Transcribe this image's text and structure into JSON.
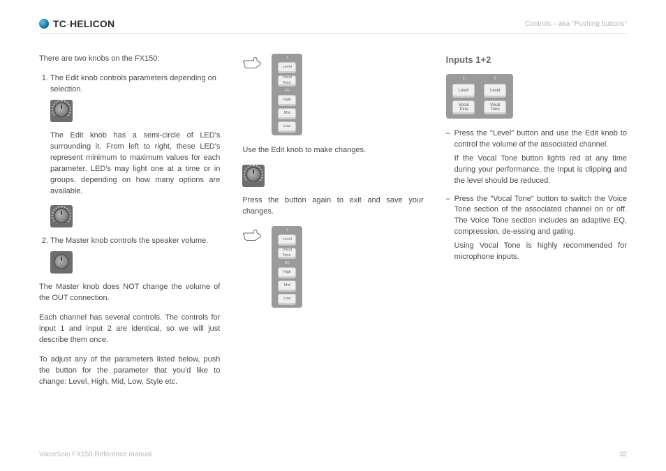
{
  "header": {
    "brand_prefix": "TC",
    "brand_suffix": "HELICON",
    "right_text": "Controls – aka \"Pushing buttons\""
  },
  "col1": {
    "intro": "There are two knobs on the FX150:",
    "item1_lead": "The Edit knob controls parameters depending on selection.",
    "item1_detail": "The Edit knob has a semi-circle of LED's surrounding it. From left to right, these LED's represent minimum to maximum values for each parameter. LED's may light one at a time or in groups, depending on how many options are available.",
    "item2_lead": "The Master knob controls the speaker volume.",
    "master_note": "The Master knob does NOT change the volume of the OUT connection.",
    "channels_note": "Each channel has several controls. The controls for input 1 and input 2 are identical, so we will just describe them once.",
    "adjust_note": "To adjust any of the parameters listed below, push the button for the parameter that you'd like to change: Level, High, Mid, Low, Style etc."
  },
  "stack": {
    "num": "1",
    "b1": "Level",
    "b2": "Vocal\nTone",
    "eq": "EQ",
    "b3": "High",
    "b4": "Mid",
    "b5": "Low"
  },
  "col2": {
    "use_edit": "Use the Edit knob to make changes.",
    "press_again": "Press the button again to exit and save your changes."
  },
  "col3": {
    "heading": "Inputs 1+2",
    "chip": {
      "h1": "1",
      "h2": "2",
      "level": "Level",
      "tone": "Vocal\nTone"
    },
    "b1_lead": "Press the \"Level\" button and use the Edit knob to control the volume of the associated channel.",
    "b1_note": "If the Vocal Tone button lights red at any time during your performance, the Input is clipping and the level should be reduced.",
    "b2_lead": "Press the \"Vocal Tone\" button to switch the Voice Tone section of the associated channel on or off. The Voice Tone section includes an adaptive EQ, compression, de-essing and gating.",
    "b2_note": "Using Vocal Tone is highly recommended for microphone inputs."
  },
  "footer": {
    "left": "VoiceSolo FX150 Reference manual",
    "right": "32"
  }
}
